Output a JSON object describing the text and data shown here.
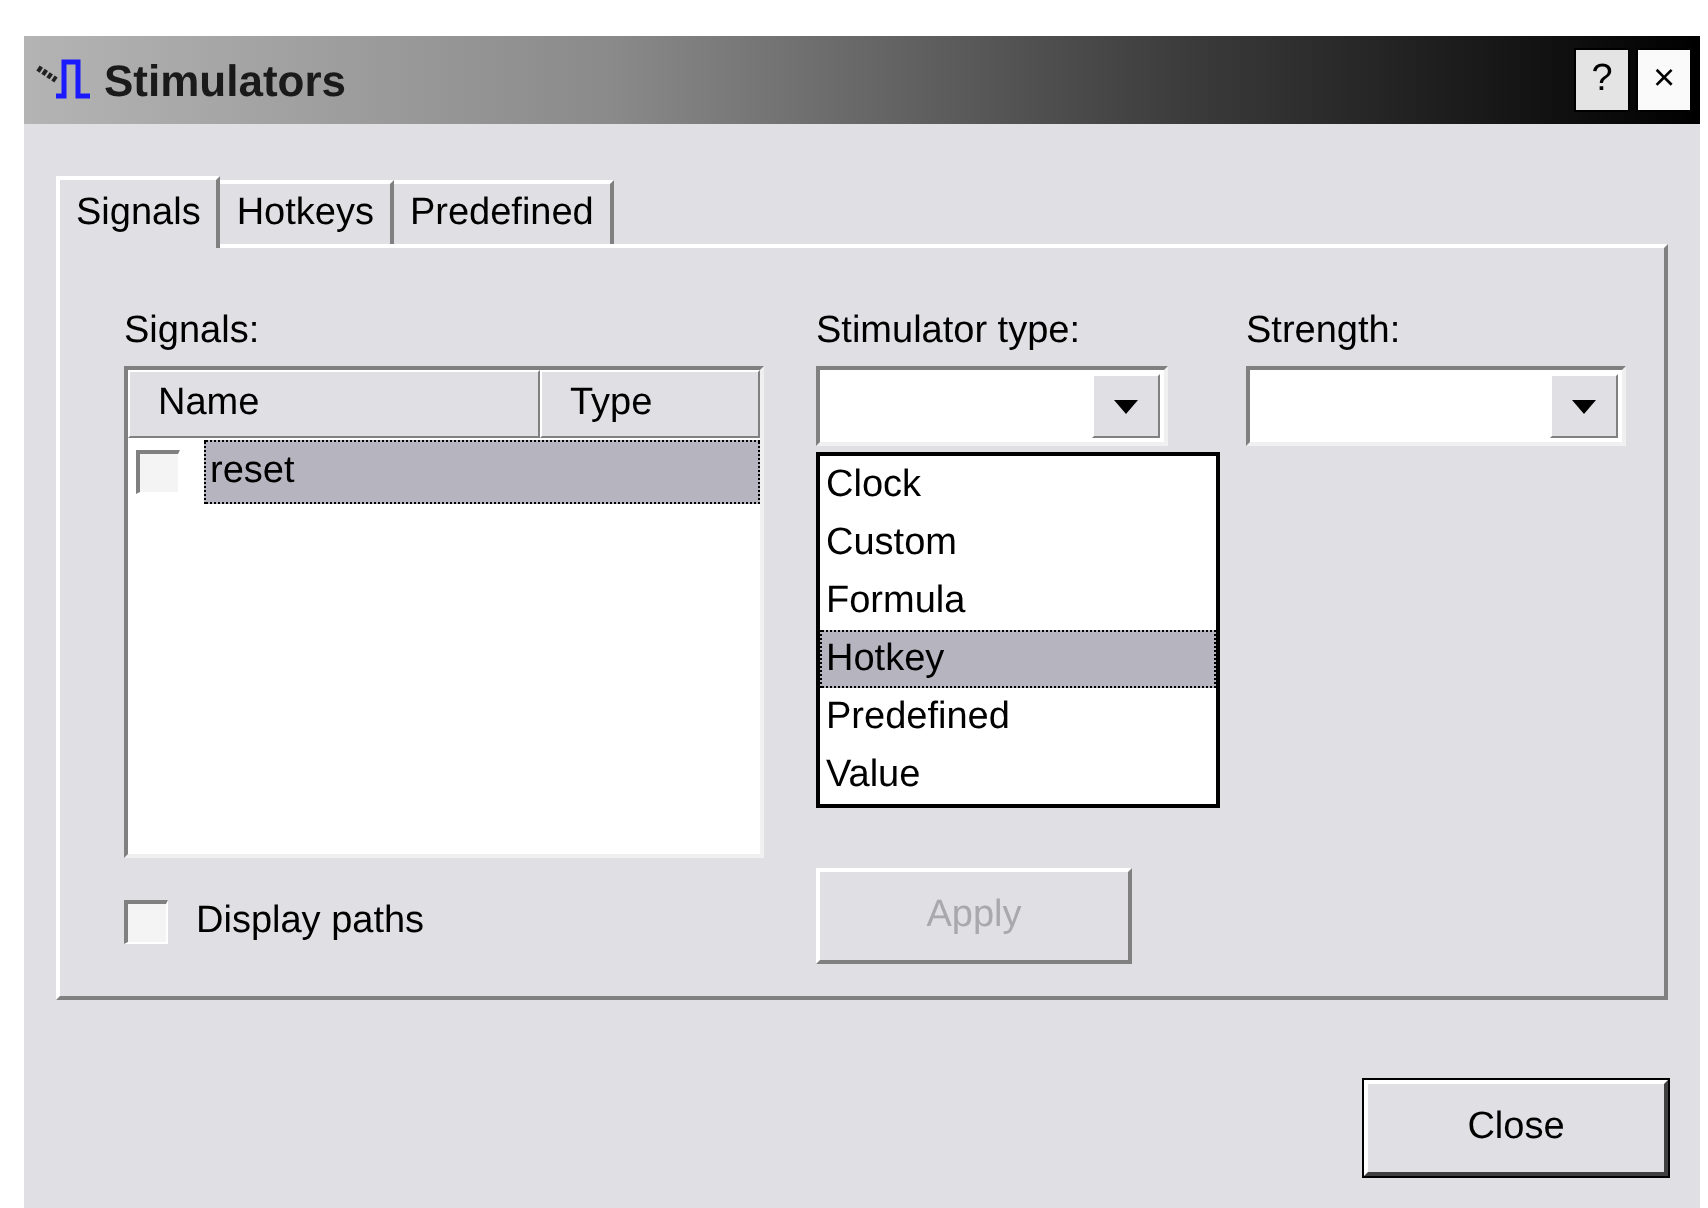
{
  "window": {
    "title": "Stimulators",
    "buttons": [
      {
        "kind": "help",
        "label": "?"
      },
      {
        "kind": "close",
        "label": "×"
      }
    ]
  },
  "tabs": [
    {
      "label": "Signals",
      "selected": true
    },
    {
      "label": "Hotkeys",
      "selected": false
    },
    {
      "label": "Predefined",
      "selected": false
    }
  ],
  "signals": {
    "label": "Signals:",
    "columns": [
      "Name",
      "Type"
    ],
    "rows": [
      {
        "name": "reset",
        "checked": false,
        "selected": true
      }
    ]
  },
  "display_paths": {
    "label": "Display paths",
    "checked": false
  },
  "stimulator_type": {
    "label": "Stimulator type:",
    "expanded": true,
    "options": [
      {
        "label": "Clock",
        "selected": false
      },
      {
        "label": "Custom",
        "selected": false
      },
      {
        "label": "Formula",
        "selected": false
      },
      {
        "label": "Hotkey",
        "selected": true
      },
      {
        "label": "Predefined",
        "selected": false
      },
      {
        "label": "Value",
        "selected": false
      }
    ]
  },
  "strength": {
    "label": "Strength:"
  },
  "apply": {
    "label": "Apply",
    "disabled": true
  },
  "close": {
    "label": "Close"
  }
}
